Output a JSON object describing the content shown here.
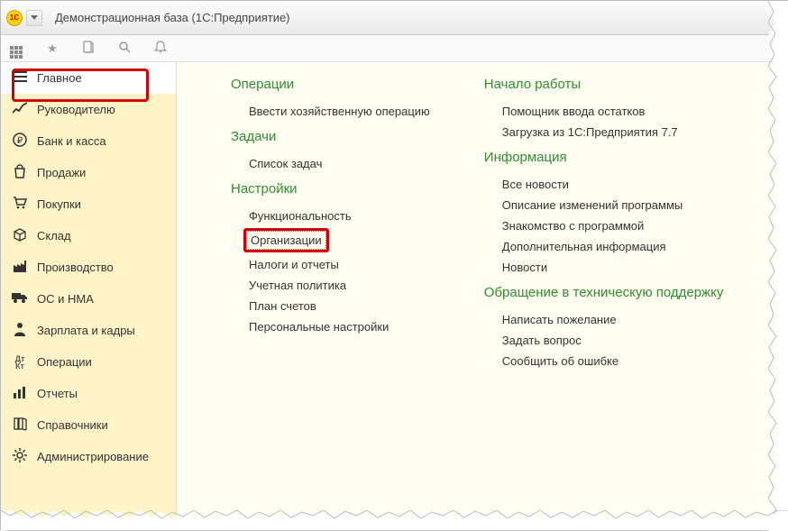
{
  "title": "Демонстрационная база  (1С:Предприятие)",
  "sidebar": {
    "items": [
      {
        "icon": "menu",
        "label": "Главное"
      },
      {
        "icon": "trend",
        "label": "Руководителю"
      },
      {
        "icon": "ruble",
        "label": "Банк и касса"
      },
      {
        "icon": "bag",
        "label": "Продажи"
      },
      {
        "icon": "cart",
        "label": "Покупки"
      },
      {
        "icon": "box",
        "label": "Склад"
      },
      {
        "icon": "factory",
        "label": "Производство"
      },
      {
        "icon": "truck",
        "label": "ОС и НМА"
      },
      {
        "icon": "person",
        "label": "Зарплата и кадры"
      },
      {
        "icon": "dtkt",
        "label": "Операции"
      },
      {
        "icon": "bars",
        "label": "Отчеты"
      },
      {
        "icon": "books",
        "label": "Справочники"
      },
      {
        "icon": "gear",
        "label": "Администрирование"
      }
    ]
  },
  "content": {
    "col1": {
      "operations": {
        "title": "Операции",
        "links": [
          "Ввести хозяйственную операцию"
        ]
      },
      "tasks": {
        "title": "Задачи",
        "links": [
          "Список задач"
        ]
      },
      "settings": {
        "title": "Настройки",
        "links_before": [
          "Функциональность"
        ],
        "highlighted": "Организации",
        "links_after": [
          "Налоги и отчеты",
          "Учетная политика",
          "План счетов",
          "Персональные настройки"
        ]
      }
    },
    "col2": {
      "start": {
        "title": "Начало работы",
        "links": [
          "Помощник ввода остатков",
          "Загрузка из 1С:Предприятия 7.7"
        ]
      },
      "info": {
        "title": "Информация",
        "links": [
          "Все новости",
          "Описание изменений программы",
          "Знакомство с программой",
          "Дополнительная информация",
          "Новости"
        ]
      },
      "support": {
        "title": "Обращение в техническую поддержку",
        "links": [
          "Написать пожелание",
          "Задать вопрос",
          "Сообщить об ошибке"
        ]
      }
    }
  }
}
